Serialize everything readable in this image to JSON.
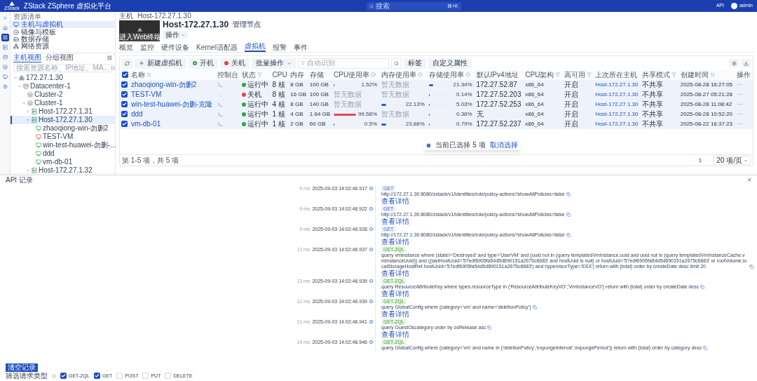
{
  "header": {
    "logo_text": "ZStack",
    "title": "ZStack ZSphere 虚拟化平台",
    "search_placeholder": "搜索",
    "shortcut": "⌘+K",
    "api_link": "API",
    "user": "admin"
  },
  "rail": [
    {
      "selected": false
    },
    {
      "selected": false
    },
    {
      "selected": true
    },
    {
      "selected": false
    },
    {
      "selected": false
    },
    {
      "selected": false
    },
    {
      "selected": false
    },
    {
      "selected": false
    }
  ],
  "sidebar": {
    "heading": "资源清单",
    "items": [
      {
        "label": "主机与虚拟机",
        "selected": true
      },
      {
        "label": "镜像与模板",
        "selected": false
      },
      {
        "label": "数据存储",
        "selected": false
      },
      {
        "label": "网络资源",
        "selected": false
      }
    ]
  },
  "tree_panel": {
    "tabs": [
      {
        "label": "主机视图",
        "selected": true
      },
      {
        "label": "分组视图",
        "selected": false
      }
    ],
    "search_placeholder": "搜索资源名称、IP地址、MA...",
    "tree": [
      {
        "label": "172.27.1.30",
        "kind": "zone",
        "expanded": true,
        "selected": false,
        "children": [
          {
            "label": "Datacenter-1",
            "kind": "datacenter",
            "expanded": true,
            "selected": false,
            "children": [
              {
                "label": "Cluster-2",
                "kind": "cluster",
                "selected": false
              },
              {
                "label": "Cluster-1",
                "kind": "cluster",
                "expanded": true,
                "selected": false,
                "children": [
                  {
                    "label": "Host-172.27.1.31",
                    "kind": "host",
                    "expanded": false,
                    "selected": false
                  },
                  {
                    "label": "Host-172.27.1.30",
                    "kind": "host",
                    "expanded": true,
                    "selected": true,
                    "children": [
                      {
                        "label": "zhaoqiong-win-勿删2",
                        "kind": "vm",
                        "running": true,
                        "selected": false
                      },
                      {
                        "label": "TEST-VM",
                        "kind": "vm",
                        "running": false,
                        "selected": false
                      },
                      {
                        "label": "win-test-huawei-勿删-...",
                        "kind": "vm",
                        "running": true,
                        "selected": false
                      },
                      {
                        "label": "ddd",
                        "kind": "vm",
                        "running": true,
                        "selected": false
                      },
                      {
                        "label": "vm-db-01",
                        "kind": "vm",
                        "running": true,
                        "selected": false
                      }
                    ]
                  },
                  {
                    "label": "Host-172.27.1.32",
                    "kind": "host",
                    "expanded": false,
                    "selected": false
                  }
                ]
              }
            ]
          }
        ]
      }
    ]
  },
  "host": {
    "breadcrumb": [
      "主机",
      "Host-172.27.1.30"
    ],
    "console_caption": "进入Web终端",
    "title": "Host-172.27.1.30",
    "badge": "管理节点",
    "actions_button": "操作"
  },
  "tabs": [
    {
      "label": "概览",
      "selected": false
    },
    {
      "label": "监控",
      "selected": false
    },
    {
      "label": "硬件设备",
      "selected": false
    },
    {
      "label": "Kernel适配器",
      "selected": false
    },
    {
      "label": "虚拟机",
      "selected": true
    },
    {
      "label": "报警",
      "selected": false
    },
    {
      "label": "事件",
      "selected": false
    }
  ],
  "toolbar": {
    "buttons": [
      {
        "label": "新建虚拟机",
        "kind": "new"
      },
      {
        "label": "开机",
        "kind": "start"
      },
      {
        "label": "关机",
        "kind": "stop"
      },
      {
        "label": "批量操作",
        "kind": "menu"
      }
    ],
    "search_placeholder": "自动识别",
    "tag_button": "标签",
    "custom_button": "自定义属性"
  },
  "table": {
    "all_checked": true,
    "columns": [
      {
        "label": "名称",
        "kind": "sortable"
      },
      {
        "label": "控制台",
        "kind": "plain"
      },
      {
        "label": "状态",
        "kind": "filterable"
      },
      {
        "label": "CPU",
        "kind": "plain"
      },
      {
        "label": "内存",
        "kind": "plain"
      },
      {
        "label": "存储",
        "kind": "plain"
      },
      {
        "label": "CPU使用率",
        "kind": "hint"
      },
      {
        "label": "内存使用率",
        "kind": "hint"
      },
      {
        "label": "存储使用率",
        "kind": "hint"
      },
      {
        "label": "默认IPv4地址",
        "kind": "plain"
      },
      {
        "label": "CPU架构",
        "kind": "filterable"
      },
      {
        "label": "高可用",
        "kind": "filterable"
      },
      {
        "label": "上次所在主机",
        "kind": "plain"
      },
      {
        "label": "共享模式",
        "kind": "filterable"
      },
      {
        "label": "创建时间",
        "kind": "sortable"
      },
      {
        "label": "操作",
        "kind": "plain"
      }
    ],
    "rows": [
      {
        "checked": true,
        "name": "zhaoqiong-win-勿删2",
        "running": true,
        "status": "运行中",
        "cpu": "8 核",
        "memory": "8 GB",
        "storage": "100 GB",
        "cpu_usage": {
          "kind": "bar",
          "level": 0.0152,
          "reading": "1.52%"
        },
        "memory_usage": {
          "kind": "empty",
          "reading": "暂无数据"
        },
        "storage_usage": {
          "kind": "bar",
          "level": 0.2134,
          "reading": "21.34%"
        },
        "ip": "172.27.52.87",
        "arch": "x86_64",
        "ha": "开启",
        "last_host": "Host-172.27.1.30",
        "share_mode": "不共享",
        "created": "2025-08-28 16:27:05",
        "actions": "···"
      },
      {
        "checked": true,
        "name": "TEST-VM",
        "running": false,
        "status": "关机",
        "cpu": "8 核",
        "memory": "16 GB",
        "storage": "100 GB",
        "cpu_usage": {
          "kind": "empty",
          "reading": "暂无数据"
        },
        "memory_usage": {
          "kind": "empty",
          "reading": "暂无数据"
        },
        "storage_usage": {
          "kind": "bar",
          "level": 0.0014,
          "reading": "0.14%"
        },
        "ip": "172.27.52.203",
        "arch": "x86_64",
        "ha": "开启",
        "last_host": "Host-172.27.1.30",
        "share_mode": "不共享",
        "created": "2025-08-27 05:21:28",
        "actions": "···"
      },
      {
        "checked": true,
        "name": "win-test-huawei-勿删-克隆",
        "running": true,
        "status": "运行中",
        "cpu": "4 核",
        "memory": "8 GB",
        "storage": "140 GB",
        "cpu_usage": {
          "kind": "empty",
          "reading": "暂无数据"
        },
        "memory_usage": {
          "kind": "bar",
          "level": 0.2213,
          "reading": "22.13%"
        },
        "storage_usage": {
          "kind": "bar",
          "level": 0.0503,
          "reading": "5.03%"
        },
        "ip": "172.27.52.253",
        "arch": "x86_64",
        "ha": "开启",
        "last_host": "Host-172.27.1.30",
        "share_mode": "不共享",
        "created": "2025-08-28 11:08:42",
        "actions": "···"
      },
      {
        "checked": true,
        "name": "ddd",
        "running": true,
        "status": "运行中",
        "cpu": "1 核",
        "memory": "4 GB",
        "storage": "1.64 GB",
        "cpu_usage": {
          "kind": "bar",
          "level": 0.9958,
          "reading": "99.58%"
        },
        "memory_usage": {
          "kind": "empty",
          "reading": "暂无数据"
        },
        "storage_usage": {
          "kind": "bar",
          "level": 0.0036,
          "reading": "0.36%"
        },
        "ip": "无",
        "arch": "x86_64",
        "ha": "开启",
        "last_host": "Host-172.27.1.30",
        "share_mode": "不共享",
        "created": "2025-08-28 10:52:20",
        "actions": "···"
      },
      {
        "checked": true,
        "name": "vm-db-01",
        "running": true,
        "status": "运行中",
        "cpu": "1 核",
        "memory": "2 GB",
        "storage": "60 GB",
        "cpu_usage": {
          "kind": "bar",
          "level": 0.005,
          "reading": "0.5%"
        },
        "memory_usage": {
          "kind": "bar",
          "level": 0.2386,
          "reading": "23.86%"
        },
        "storage_usage": {
          "kind": "bar",
          "level": 0.0079,
          "reading": "0.79%"
        },
        "ip": "172.27.52.237",
        "arch": "x86_64",
        "ha": "开启",
        "last_host": "Host-172.27.1.30",
        "share_mode": "不共享",
        "created": "2025-08-22 16:37:23",
        "actions": "···"
      }
    ]
  },
  "selection_popup": {
    "text": "当前已选择 5 项",
    "action": "取消选择"
  },
  "pagination": {
    "summary": "第 1-5 项，共 5 项",
    "page": "1",
    "page_size": "20 项/页"
  },
  "api_panel": {
    "title": "API 记录",
    "close": "×",
    "clear_button": "清空记录",
    "filter_label": "筛选请求类型",
    "filters": [
      {
        "label": "GET-ZQL",
        "checked": true
      },
      {
        "label": "GET",
        "checked": true
      },
      {
        "label": "POST",
        "checked": false
      },
      {
        "label": "PUT",
        "checked": false
      },
      {
        "label": "DELETE",
        "checked": false
      }
    ],
    "entries": [
      {
        "duration": "9 ms",
        "time": "2025-09-03 14:02:46.917",
        "method": "GET",
        "kind": "rest",
        "request": "http://172.27.1.30:8080/zstack/v1/identities/role/policy-actions?showAllPolicies=false",
        "details_link": "查看详情"
      },
      {
        "duration": "9 ms",
        "time": "2025-09-03 14:02:46.922",
        "method": "GET",
        "kind": "rest",
        "request": "http://172.27.1.30:8080/zstack/v1/identities/role/policy-actions?showAllPolicies=false",
        "details_link": "查看详情"
      },
      {
        "duration": "9 ms",
        "time": "2025-09-03 14:02:46.928",
        "method": "GET",
        "kind": "rest",
        "request": "http://172.27.1.30:8080/zstack/v1/identities/role/policy-actions?showAllPolicies=false",
        "details_link": "查看详情"
      },
      {
        "duration": "11 ms",
        "time": "2025-09-03 14:02:46.937",
        "method": "GET-ZQL",
        "kind": "zql",
        "request": "query vminstance where (state!='Destroyed' and type='UserVM' and (uuid not in (query templatedVmInstance.uuid and uuid not in (query templatedVmInstanceCache.vmInstanceUuid)) and ((lastHostUuid='57edf6905fa54d5d890151a2675c6683' and hostUuid is null) or hostUuid='57edf6905fa54d5d890151a2675c6683' or rootVolume.localStorageHostRef.hostUuid='57edf6905fa54d5d890151a2675c6683') and hypervisorType='ESX') return with (total) order by createDate desc limit 20",
        "details_link": "查看详情"
      },
      {
        "duration": "11 ms",
        "time": "2025-09-03 14:02:46.939",
        "method": "GET-ZQL",
        "kind": "zql",
        "request": "query ResourceAttributeKey where types.resourceType in ('ResourceAttributeKeyVO','VmInstanceVO') return with (total) order by createDate desc",
        "details_link": "查看详情"
      },
      {
        "duration": "11 ms",
        "time": "2025-09-03 14:02:46.939",
        "method": "GET-ZQL",
        "kind": "zql",
        "request": "query GlobalConfig where (category='vm' and name='deletionPolicy')",
        "details_link": "查看详情"
      },
      {
        "duration": "11 ms",
        "time": "2025-09-03 14:02:46.941",
        "method": "GET-ZQL",
        "kind": "zql",
        "request": "query GuestOscategory order by osRelease asc",
        "details_link": "查看详情"
      },
      {
        "duration": "14 ms",
        "time": "2025-09-03 14:02:46.946",
        "method": "GET-ZQL",
        "kind": "zql",
        "request": "query GlobalConfig where (category='vm' and name in ('deletionPolicy','expungeInterval','expungePeriod')) return with (total) order by category desc"
      }
    ]
  }
}
